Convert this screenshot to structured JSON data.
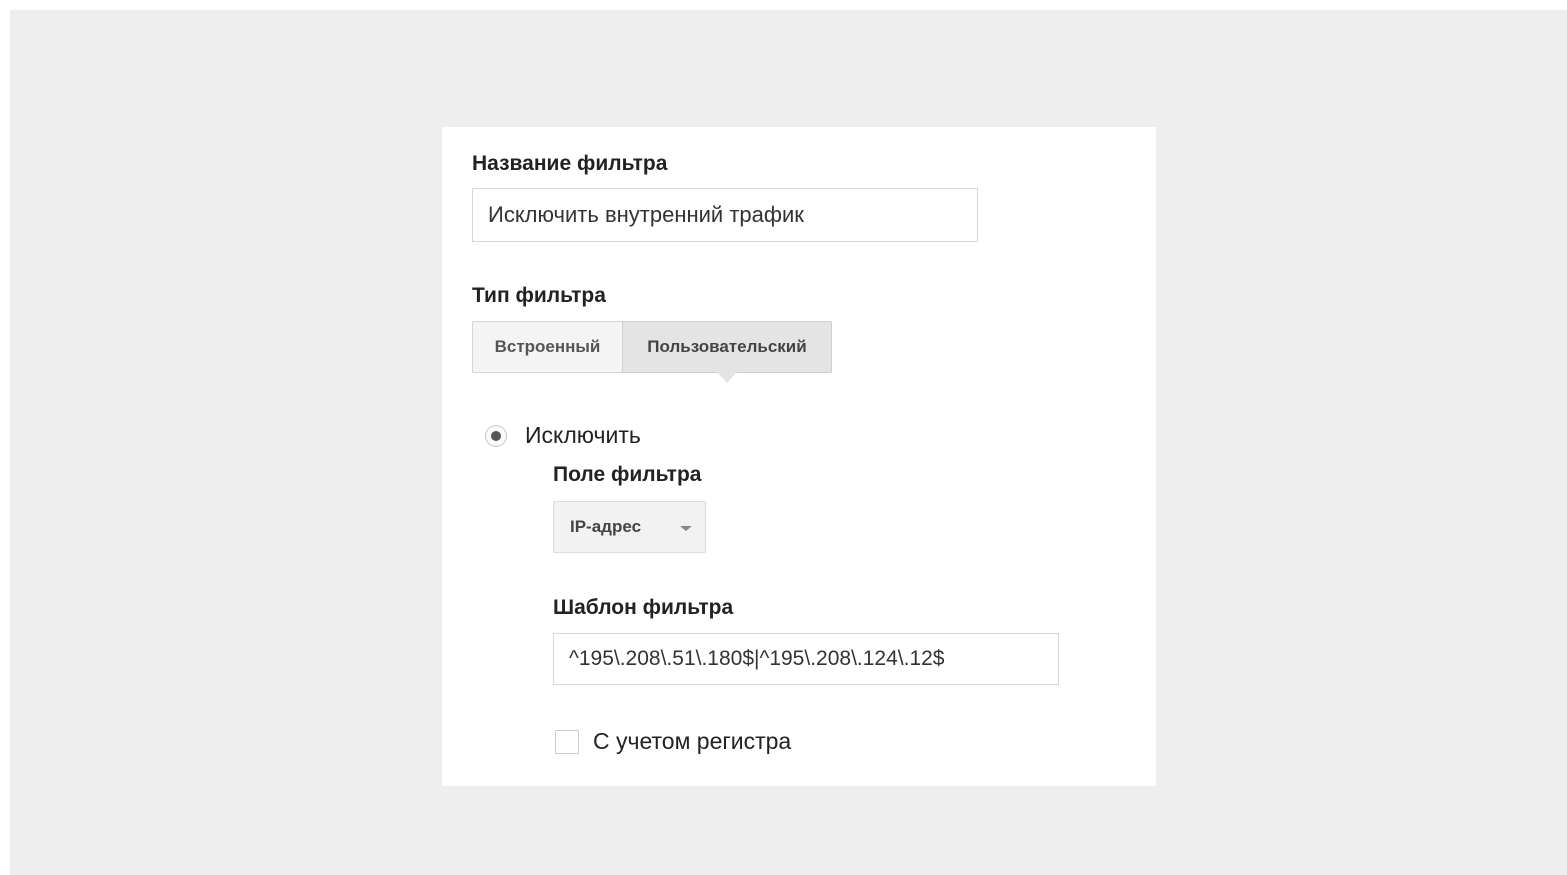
{
  "form": {
    "filter_name": {
      "label": "Название фильтра",
      "value": "Исключить внутренний трафик"
    },
    "filter_type": {
      "label": "Тип фильтра",
      "options": [
        "Встроенный",
        "Пользовательский"
      ],
      "selected": "Пользовательский"
    },
    "mode": {
      "label": "Исключить",
      "checked": true
    },
    "filter_field": {
      "label": "Поле фильтра",
      "selected": "IP-адрес"
    },
    "filter_pattern": {
      "label": "Шаблон фильтра",
      "value": "^195\\.208\\.51\\.180$|^195\\.208\\.124\\.12$"
    },
    "case_sensitive": {
      "label": "С учетом регистра",
      "checked": false
    }
  },
  "colors": {
    "backdrop": "#eeeeee",
    "panel": "#ffffff",
    "selected_segment": "#e4e4e4"
  }
}
